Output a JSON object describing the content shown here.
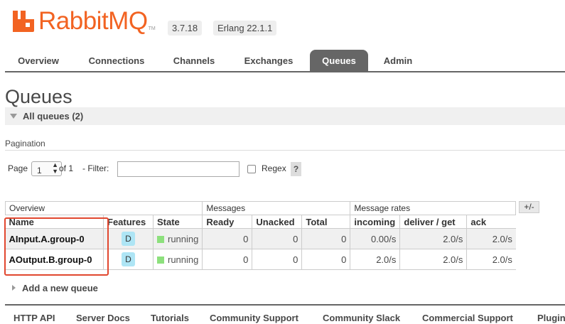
{
  "header": {
    "logo_text": "RabbitMQ",
    "logo_tm": "TM",
    "version": "3.7.18",
    "erlang": "Erlang 22.1.1"
  },
  "nav": {
    "tabs": [
      {
        "label": "Overview"
      },
      {
        "label": "Connections"
      },
      {
        "label": "Channels"
      },
      {
        "label": "Exchanges"
      },
      {
        "label": "Queues",
        "active": true
      },
      {
        "label": "Admin"
      }
    ]
  },
  "page": {
    "title": "Queues",
    "section_label": "All queues (2)"
  },
  "pagination": {
    "heading": "Pagination",
    "page_label": "Page",
    "page_value": "1",
    "of_label": "of 1",
    "filter_label": "- Filter:",
    "filter_value": "",
    "regex_label": "Regex",
    "help_label": "?"
  },
  "table": {
    "groups": {
      "overview": "Overview",
      "messages": "Messages",
      "rates": "Message rates",
      "toggle": "+/-"
    },
    "columns": {
      "name": "Name",
      "features": "Features",
      "state": "State",
      "ready": "Ready",
      "unacked": "Unacked",
      "total": "Total",
      "incoming": "incoming",
      "deliver": "deliver / get",
      "ack": "ack"
    },
    "rows": [
      {
        "name": "AInput.A.group-0",
        "feature": "D",
        "state": "running",
        "ready": "0",
        "unacked": "0",
        "total": "0",
        "incoming": "0.00/s",
        "deliver": "2.0/s",
        "ack": "2.0/s"
      },
      {
        "name": "AOutput.B.group-0",
        "feature": "D",
        "state": "running",
        "ready": "0",
        "unacked": "0",
        "total": "0",
        "incoming": "2.0/s",
        "deliver": "2.0/s",
        "ack": "2.0/s"
      }
    ]
  },
  "add_queue_label": "Add a new queue",
  "footer": {
    "links": [
      "HTTP API",
      "Server Docs",
      "Tutorials",
      "Community Support",
      "Community Slack",
      "Commercial Support",
      "Plugins"
    ]
  },
  "colors": {
    "brand": "#f26322",
    "nav_active": "#666666",
    "running": "#8de07d",
    "durable_badge": "#aee5f5",
    "highlight": "#e1472f"
  }
}
